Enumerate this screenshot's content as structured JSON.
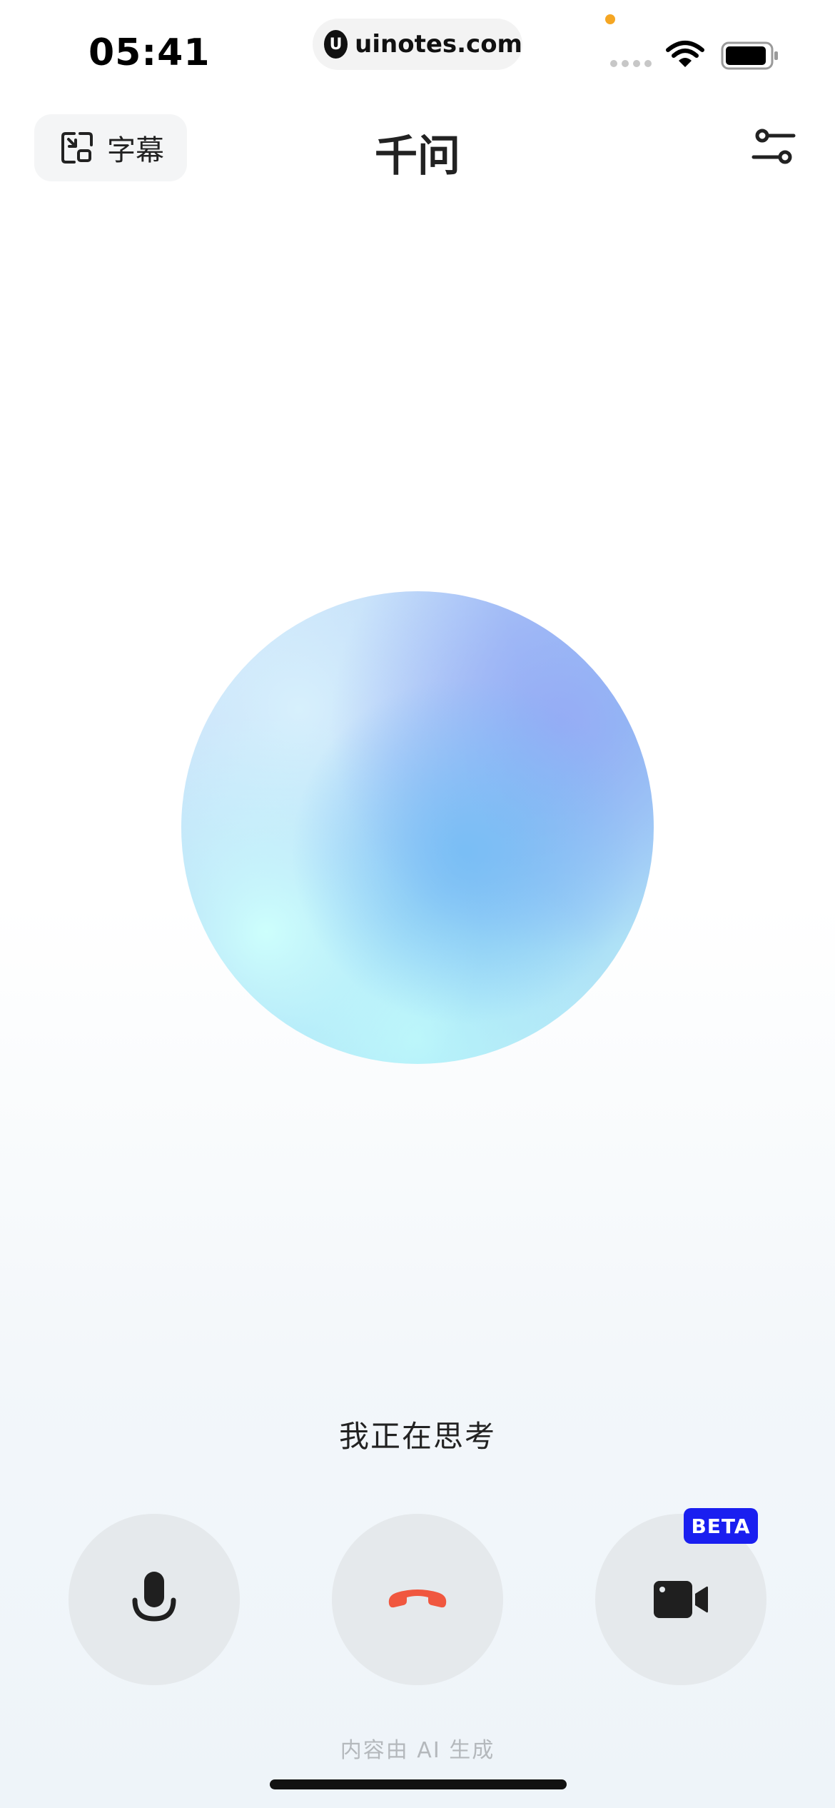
{
  "status_bar": {
    "time": "05:41",
    "url": "uinotes.com",
    "url_logo": "U"
  },
  "header": {
    "subtitle_label": "字幕",
    "title": "千问",
    "settings_icon": "sliders-icon"
  },
  "main": {
    "status_text": "我正在思考"
  },
  "controls": {
    "mic_icon": "microphone-icon",
    "hangup_icon": "phone-hangup-icon",
    "video_icon": "video-camera-icon",
    "beta_badge": "BETA"
  },
  "footer": {
    "disclaimer": "内容由 AI 生成"
  },
  "colors": {
    "hangup_red": "#f0573f",
    "beta_blue": "#1a1ff0",
    "control_bg": "#e5e9ec"
  }
}
